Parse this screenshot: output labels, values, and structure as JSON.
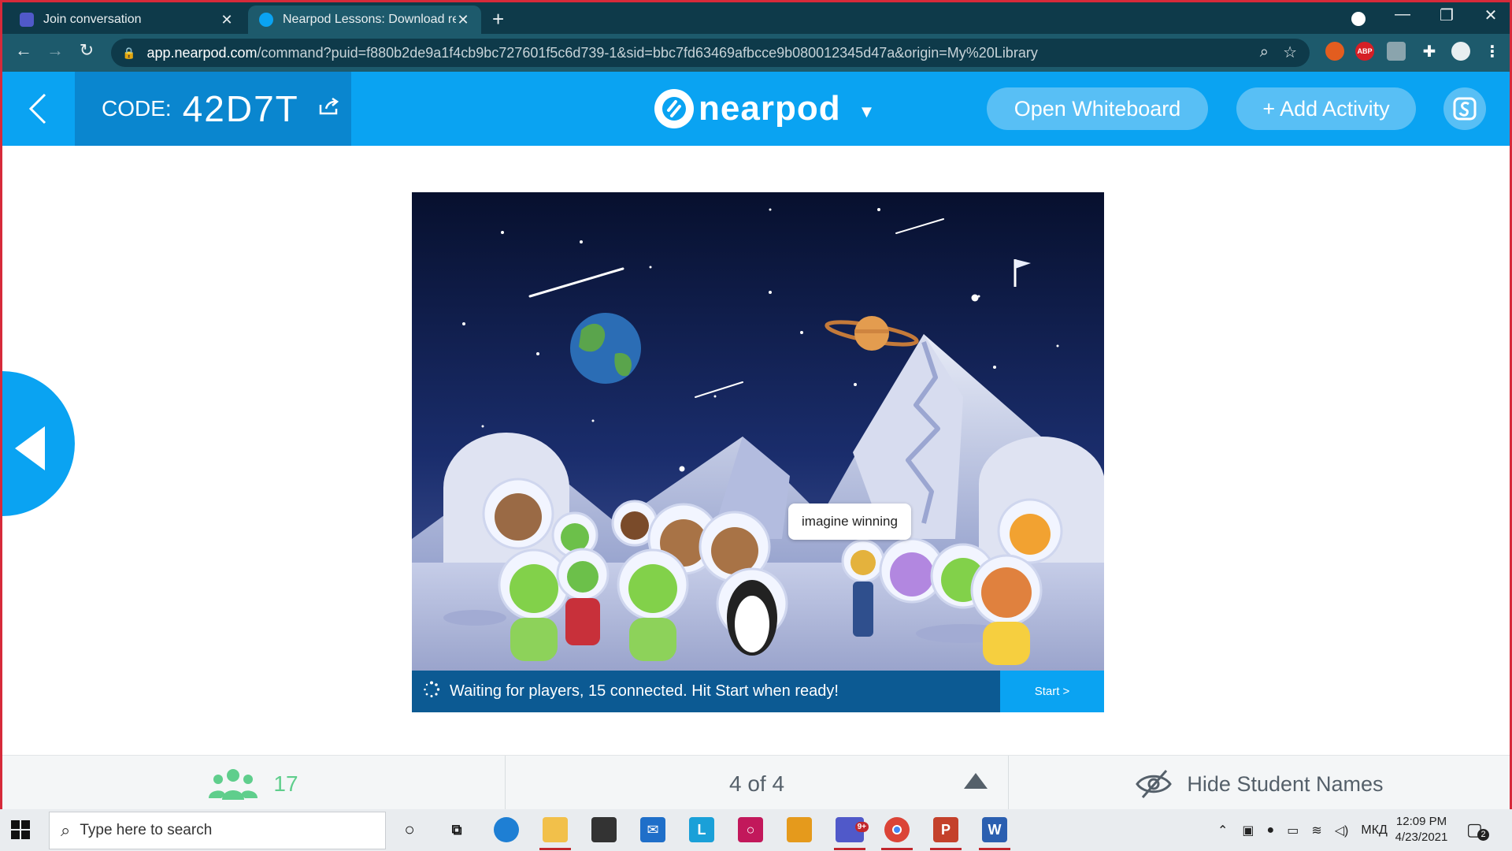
{
  "browser": {
    "tabs": [
      {
        "title": "Join conversation",
        "active": false,
        "favicon_color": "#5059c9"
      },
      {
        "title": "Nearpod Lessons: Download rea",
        "active": true,
        "favicon_color": "#0aa3f2"
      }
    ],
    "new_tab": "+",
    "window_controls": {
      "minimize": "—",
      "restore": "❐",
      "close": "✕"
    },
    "url_host": "app.nearpod.com",
    "url_path": "/command?puid=f880b2de9a1f4cb9bc727601f5c6d739-1&sid=bbc7fd63469afbcce9b080012345d47a&origin=My%20Library",
    "ext_abp": "ABP"
  },
  "header": {
    "code_label": "CODE:",
    "code_value": "42D7T",
    "logo_text": "nearpod",
    "whiteboard_label": "Open Whiteboard",
    "add_activity_label": "+ Add Activity",
    "accent": "#0aa3f2"
  },
  "game": {
    "speech_bubble": "imagine winning",
    "status_text": "Waiting for players, 15 connected. Hit Start when ready!",
    "start_label": "Start >"
  },
  "footer": {
    "student_count": "17",
    "page_indicator": "4 of 4",
    "hide_names_label": "Hide Student Names"
  },
  "taskbar": {
    "search_placeholder": "Type here to search",
    "tray_language": "МКД",
    "clock_time": "12:09 PM",
    "clock_date": "4/23/2021",
    "notification_count": "2",
    "teams_badge": "9+"
  }
}
